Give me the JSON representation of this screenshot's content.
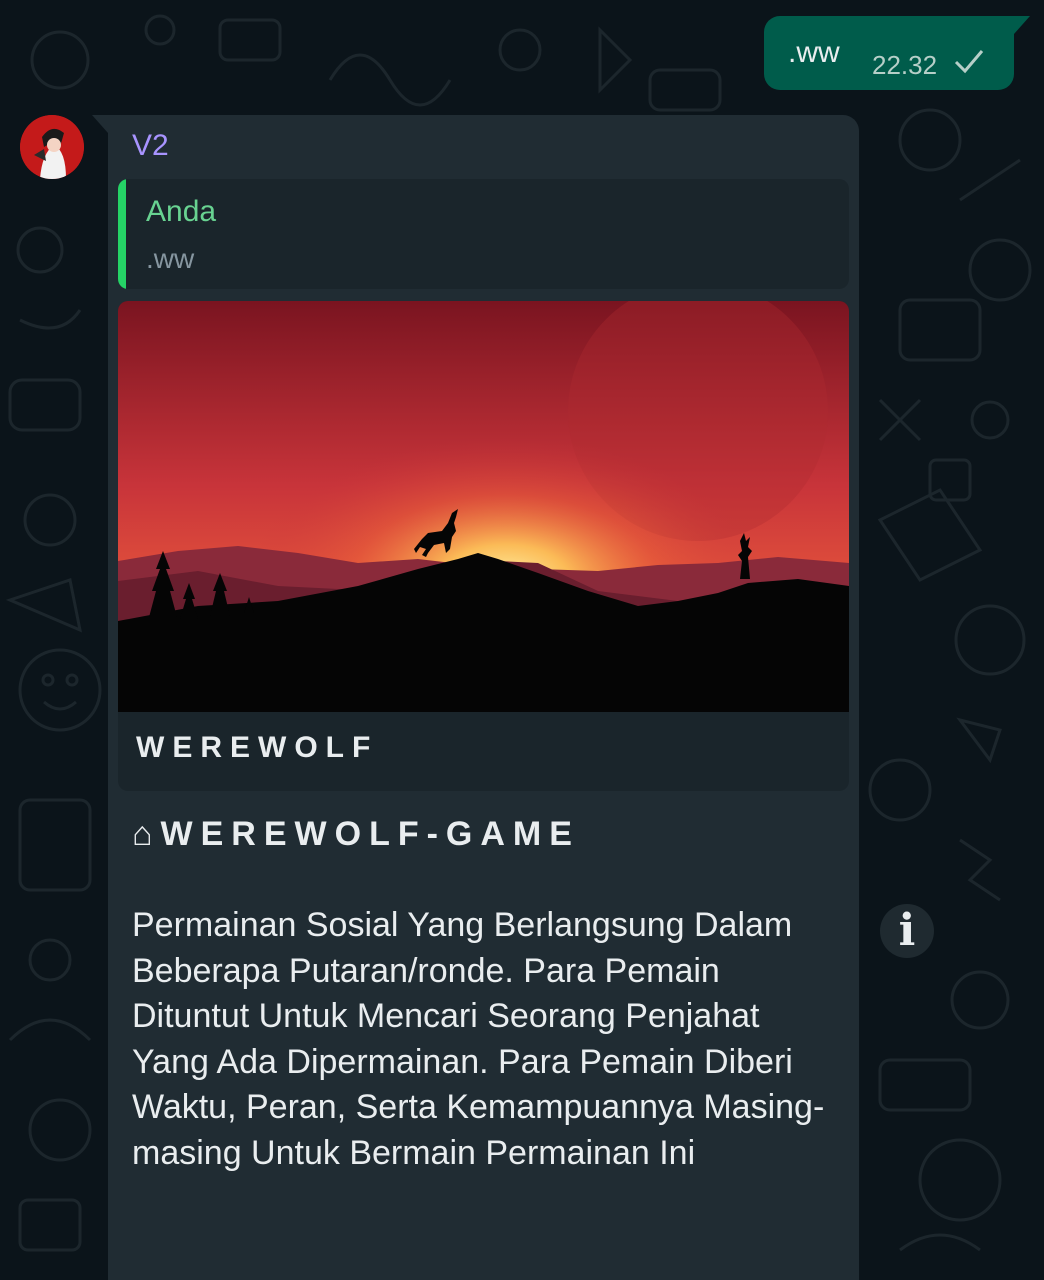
{
  "outgoing_message": {
    "text": ".ww",
    "time": "22.32",
    "status_icon": "single-check-icon"
  },
  "incoming_message": {
    "sender": "V2",
    "quoted": {
      "author": "Anda",
      "text": ".ww"
    },
    "link_preview": {
      "title": "WEREWOLF"
    },
    "heading": "⌂WEREWOLF-GAME",
    "body": "Permainan Sosial Yang Berlangsung Dalam Beberapa Putaran/ronde. Para Pemain Dituntut Untuk Mencari Seorang Penjahat Yang Ada Dipermainan. Para Pemain Diberi Waktu, Peran, Serta Kemampuannya Masing-masing Untuk Bermain Permainan Ini"
  },
  "info_button": {
    "label": "i"
  },
  "colors": {
    "chat_background": "#0b141a",
    "outgoing_bubble": "#005c4b",
    "incoming_bubble": "#202c33",
    "sender_name": "#a894ff",
    "quote_accent": "#25d366"
  }
}
